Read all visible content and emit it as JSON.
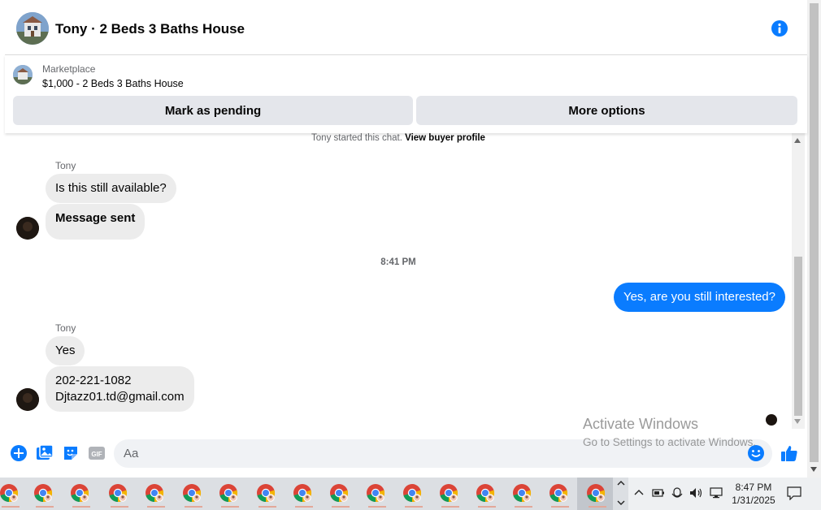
{
  "header": {
    "title": "Tony · 2 Beds 3 Baths House"
  },
  "marketplace": {
    "label": "Marketplace",
    "listing": "$1,000 - 2 Beds 3 Baths House",
    "pending_button": "Mark as pending",
    "more_button": "More options"
  },
  "chat": {
    "started_text": "Tony started this chat.",
    "buyer_profile_link": "View buyer profile",
    "sender_name_1": "Tony",
    "msg1": "Is this still available?",
    "msg2": "Message sent",
    "timestamp": "8:41 PM",
    "out_msg": "Yes, are you still interested?",
    "sender_name_2": "Tony",
    "msg3": "Yes",
    "msg4_line1": "202-221-1082",
    "msg4_line2": "Djtazz01.td@gmail.com"
  },
  "composer": {
    "placeholder": "Aa"
  },
  "watermark": {
    "line1": "Activate Windows",
    "line2": "Go to Settings to activate Windows."
  },
  "taskbar": {
    "time": "8:47 PM",
    "date": "1/31/2025"
  },
  "colors": {
    "accent": "#0a7cff",
    "incoming_bubble": "#ececec",
    "button_bg": "#e4e6eb"
  },
  "icons": {
    "header_info": "info-icon",
    "composer": [
      "plus-icon",
      "gallery-icon",
      "sticker-icon",
      "gif-icon",
      "emoji-icon",
      "thumbs-up-icon"
    ]
  }
}
